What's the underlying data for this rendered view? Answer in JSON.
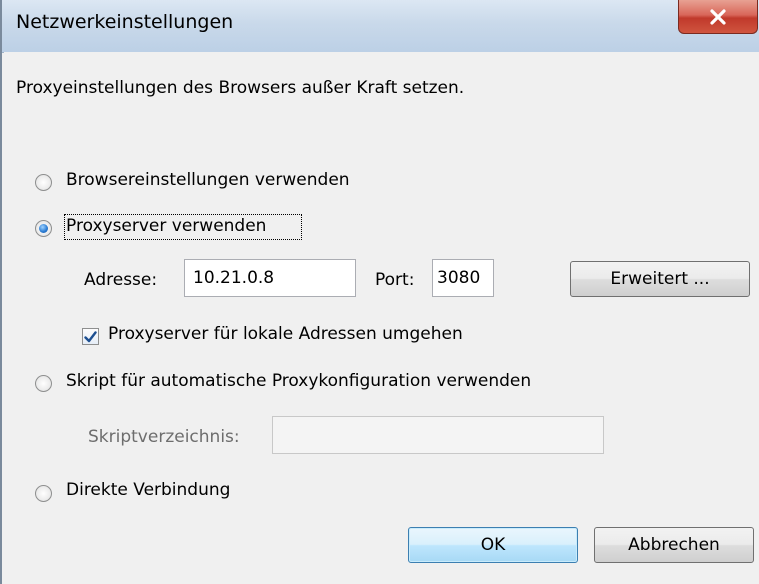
{
  "window": {
    "title": "Netzwerkeinstellungen",
    "close_symbol": "X"
  },
  "dialog": {
    "intro": "Proxyeinstellungen des Browsers außer Kraft setzen.",
    "options": {
      "browser": {
        "label": "Browsereinstellungen verwenden",
        "selected": false
      },
      "proxy": {
        "label": "Proxyserver verwenden",
        "selected": true
      },
      "script": {
        "label": "Skript für automatische Proxykonfiguration verwenden",
        "selected": false
      },
      "direct": {
        "label": "Direkte Verbindung",
        "selected": false
      }
    },
    "address": {
      "label": "Adresse:",
      "value": "10.21.0.8"
    },
    "port": {
      "label": "Port:",
      "value": "3080"
    },
    "advanced_button": "Erweitert ...",
    "bypass_local": {
      "label": "Proxyserver für lokale Adressen umgehen",
      "checked": true
    },
    "script_dir": {
      "label": "Skriptverzeichnis:",
      "value": ""
    },
    "ok_button": "OK",
    "cancel_button": "Abbrechen"
  },
  "colors": {
    "accent": "#2f7fd6",
    "close_red": "#c0392b",
    "background": "#f0f0f0"
  }
}
